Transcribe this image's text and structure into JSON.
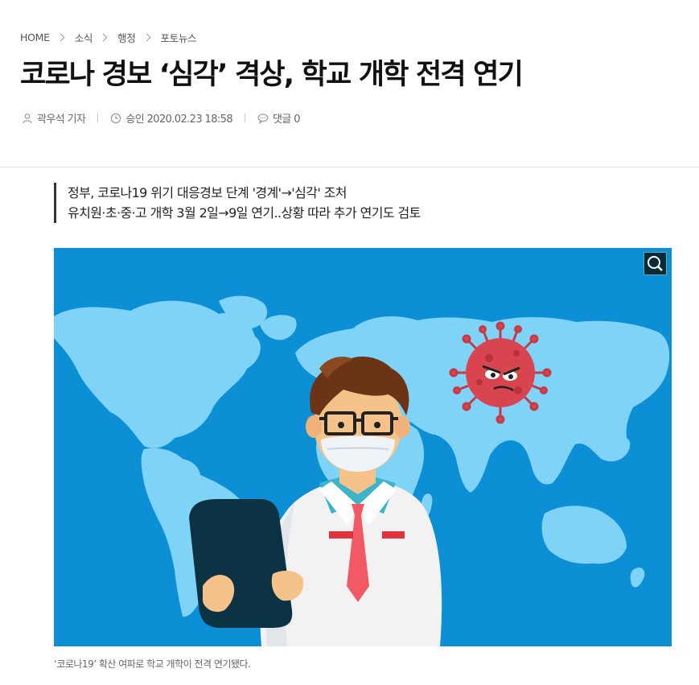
{
  "breadcrumb": {
    "items": [
      "HOME",
      "소식",
      "행정",
      "포토뉴스"
    ]
  },
  "article": {
    "title": "코로나 경보 ‘심각’ 격상, 학교 개학 전격 연기",
    "author": "곽우석 기자",
    "approved": "승인 2020.02.23 18:58",
    "comments": "댓글 0",
    "summary": [
      "정부, 코로나19 위기 대응경보 단계 '경계'→'심각' 조처",
      "유치원·초·중·고 개학 3월 2일→9일 연기..상황 따라 추가 연기도 검토"
    ],
    "photo": {
      "icon": "magnifier-icon",
      "caption": "‘코로나19’ 확산 여파로 학교 개학이 전격 연기됐다."
    }
  },
  "colors": {
    "photo_background": "#0d8fd6",
    "map_land": "#7fd3f7",
    "virus": "#d9454f",
    "title_text": "#111111"
  }
}
